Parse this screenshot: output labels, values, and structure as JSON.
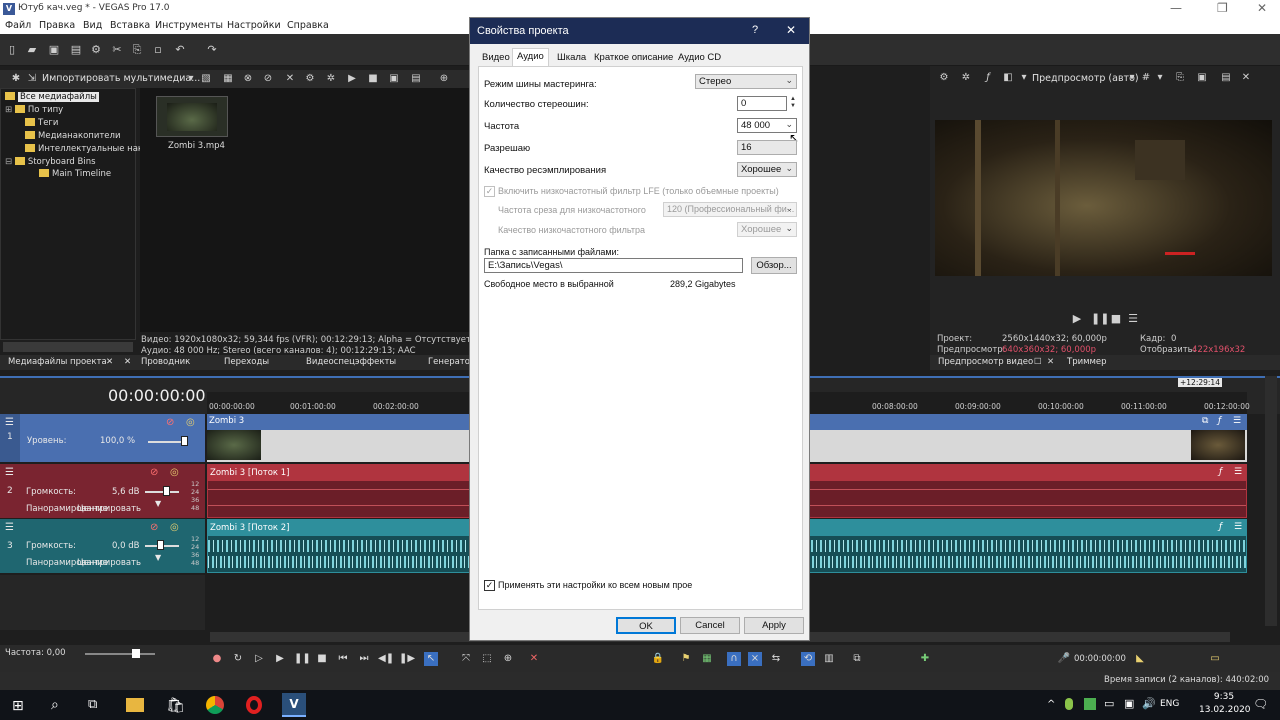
{
  "window": {
    "title": "Ютуб кач.veg * - VEGAS Pro 17.0",
    "logo": "V"
  },
  "menu": [
    "Файл",
    "Правка",
    "Вид",
    "Вставка",
    "Инструменты",
    "Настройки",
    "Справка"
  ],
  "media_toolbar": {
    "import_label": "Импортировать мультимедиа..."
  },
  "explorer": {
    "items": [
      {
        "label": "Все медиафайлы",
        "selected": true
      },
      {
        "label": "По типу"
      },
      {
        "label": "Теги"
      },
      {
        "label": "Медианакопители"
      },
      {
        "label": "Интеллектуальные нак"
      },
      {
        "label": "Storyboard Bins"
      },
      {
        "label": "Main Timeline"
      }
    ]
  },
  "media": {
    "file_name": "Zombi 3.mp4",
    "info_video": "Видео: 1920x1080x32; 59,344 fps (VFR); 00:12:29:13; Alpha = Отсутствует; Field",
    "info_audio": "Аудио: 48 000 Hz; Stereo (всего каналов: 4); 00:12:29:13; AAC"
  },
  "bottom_tabs": [
    "Медиафайлы проекта",
    "Проводник",
    "Переходы",
    "Видеоспецэффекты",
    "Генератор"
  ],
  "preview": {
    "mode_label": "Предпросмотр (авто)",
    "project_label": "Проект:",
    "project_value": "2560x1440x32; 60,000p",
    "preview_label": "Предпросмотр:",
    "preview_value": "640x360x32; 60,000p",
    "frame_label": "Кадр:",
    "frame_value": "0",
    "display_label": "Отобразить:",
    "display_value": "422x196x32",
    "tabs": [
      "Предпросмотр видео",
      "Триммер"
    ],
    "accent_color": "#e0506a"
  },
  "timeline": {
    "timecode": "00:00:00:00",
    "end_marker": "+12:29:14",
    "ruler": [
      "00:00:00:00",
      "00:01:00:00",
      "00:02:00:00",
      "00:08:00:00",
      "00:09:00:00",
      "00:10:00:00",
      "00:11:00:00",
      "00:12:00:00"
    ],
    "tracks": [
      {
        "num": "1",
        "level_label": "Уровень:",
        "level_value": "100,0 %",
        "clip": "Zombi 3",
        "color": "#4a6fb0"
      },
      {
        "num": "2",
        "level_label": "Громкость:",
        "level_value": "5,6 dB",
        "pan_label": "Панорамирование",
        "pan_value": "Центрировать",
        "clip": "Zombi 3 [Поток 1]",
        "color": "#b0343f"
      },
      {
        "num": "3",
        "level_label": "Громкость:",
        "level_value": "0,0 dB",
        "pan_label": "Панорамирование",
        "pan_value": "Центрировать",
        "clip": "Zombi 3 [Поток 2]",
        "color": "#2e8f9c"
      }
    ],
    "meter_ticks": [
      "12",
      "24",
      "36",
      "48"
    ]
  },
  "transport": {
    "rate_label": "Частота: 0,00",
    "time": "00:00:00:00"
  },
  "status": {
    "record_time": "Время записи (2 каналов): 440:02:00"
  },
  "taskbar": {
    "lang": "ENG",
    "time": "9:35",
    "date": "13.02.2020"
  },
  "dialog": {
    "title": "Свойства проекта",
    "help": "?",
    "close": "✕",
    "tabs": [
      "Видео",
      "Аудио",
      "Шкала",
      "Краткое описание",
      "Аудио CD"
    ],
    "active_tab": 1,
    "fields": {
      "master_bus_label": "Режим шины мастеринга:",
      "master_bus_value": "Стерео",
      "stereo_buses_label": "Количество стереошин:",
      "stereo_buses_value": "0",
      "rate_label": "Частота",
      "rate_value": "48 000",
      "bit_depth_label": "Разрешаю",
      "bit_depth_value": "16",
      "resample_label": "Качество ресэмплирования",
      "resample_value": "Хорошее",
      "lfe_label": "Включить низкочастотный фильтр LFE (только объемные проекты)",
      "cutoff_label": "Частота среза для низкочастотного",
      "cutoff_value": "120 (Профессиональный фи...",
      "lfe_quality_label": "Качество низкочастотного фильтра",
      "lfe_quality_value": "Хорошее",
      "folder_label": "Папка с записанными файлами:",
      "folder_value": "E:\\Запись\\Vegas\\",
      "browse_label": "Обзор...",
      "free_space_label": "Свободное место в выбранной",
      "free_space_value": "289,2 Gigabytes",
      "apply_all_label": "Применять эти настройки ко всем новым прое"
    },
    "buttons": {
      "ok": "OK",
      "cancel": "Cancel",
      "apply": "Apply"
    },
    "title_color": "#1c2c55"
  }
}
